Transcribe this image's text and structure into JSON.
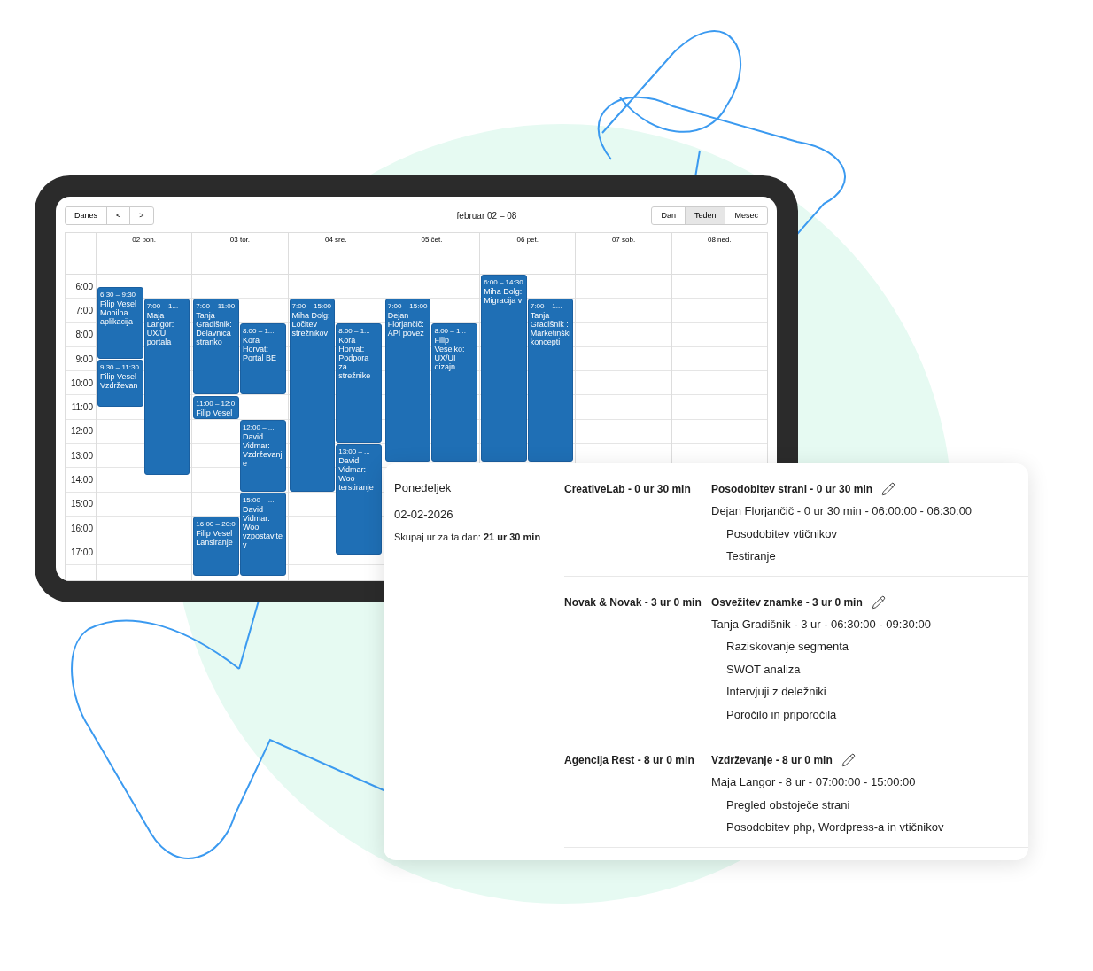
{
  "calendar": {
    "nav_buttons": [
      "Danes",
      "<",
      ">"
    ],
    "title": "februar 02 – 08",
    "view_buttons": [
      {
        "label": "Dan",
        "selected": false
      },
      {
        "label": "Teden",
        "selected": true
      },
      {
        "label": "Mesec",
        "selected": false
      }
    ],
    "hours": [
      "6:00",
      "7:00",
      "8:00",
      "9:00",
      "10:00",
      "11:00",
      "12:00",
      "13:00",
      "14:00",
      "15:00",
      "16:00",
      "17:00"
    ],
    "days": [
      {
        "label": "02 pon.",
        "events": [
          {
            "time": "6:30 – 9:30",
            "title": "Filip Vesel Mobilna aplikacija i"
          },
          {
            "time": "7:00 – 1...",
            "title": "Maja Langor: UX/UI portala"
          },
          {
            "time": "9:30 – 11:30",
            "title": "Filip Vesel Vzdrževan"
          }
        ]
      },
      {
        "label": "03 tor.",
        "events": [
          {
            "time": "7:00 – 11:00",
            "title": "Tanja Gradišnik: Delavnica stranko"
          },
          {
            "time": "8:00 – 1...",
            "title": "Kora Horvat: Portal BE"
          },
          {
            "time": "11:00 – 12:0",
            "title": "Filip Vesel"
          },
          {
            "time": "12:00 – ...",
            "title": "David Vidmar: Vzdrževanje"
          },
          {
            "time": "16:00 – 20:0",
            "title": "Filip Vesel Lansiranje"
          },
          {
            "time": "15:00 – ...",
            "title": "David Vidmar: Woo vzpostavitev"
          }
        ]
      },
      {
        "label": "04 sre.",
        "events": [
          {
            "time": "7:00 – 15:00",
            "title": "Miha Dolg: Ločitev strežnikov"
          },
          {
            "time": "8:00 – 1...",
            "title": "Kora Horvat: Podpora za strežnike"
          },
          {
            "time": "13:00 – ...",
            "title": "David Vidmar: Woo terstiranje"
          }
        ]
      },
      {
        "label": "05 čet.",
        "events": [
          {
            "time": "7:00 – 15:00",
            "title": "Dejan Florjančič: API povez"
          },
          {
            "time": "8:00 – 1...",
            "title": "Filip Veselko: UX/UI dizajn"
          }
        ]
      },
      {
        "label": "06 pet.",
        "events": [
          {
            "time": "6:00 – 14:30",
            "title": "Miha Dolg: Migracija v"
          },
          {
            "time": "7:00 – 1...",
            "title": "Tanja Gradišnik : Marketinški koncepti"
          }
        ]
      },
      {
        "label": "07 sob."
      },
      {
        "label": "08 ned."
      }
    ]
  },
  "day_summary": {
    "day": "Ponedeljek",
    "date": "02-02-2026",
    "total_label": "Skupaj ur za ta dan: **21 ur 30 min**",
    "clients": [
      {
        "client": "CreativeLab - 0 ur 30 min",
        "project": "Posodobitev strani - 0 ur 30 min",
        "person": "Dejan Florjančič - 0 ur 30 min - 06:00:00 - 06:30:00",
        "tasks": [
          "Posodobitev vtičnikov",
          "Testiranje"
        ]
      },
      {
        "client": "Novak & Novak - 3 ur 0 min",
        "project": "Osvežitev znamke - 3 ur 0 min",
        "person": "Tanja Gradišnik - 3 ur - 06:30:00 - 09:30:00",
        "tasks": [
          "Raziskovanje segmenta",
          "SWOT analiza",
          "Intervjuji z deležniki",
          "Poročilo in priporočila"
        ]
      },
      {
        "client": "Agencija Rest - 8 ur 0 min",
        "project": "Vzdrževanje - 8 ur 0 min",
        "person": "Maja Langor - 8 ur - 07:00:00 - 15:00:00",
        "tasks": [
          "Pregled obstoječe strani",
          "Posodobitev php, Wordpress-a in vtičnikov"
        ]
      }
    ]
  }
}
